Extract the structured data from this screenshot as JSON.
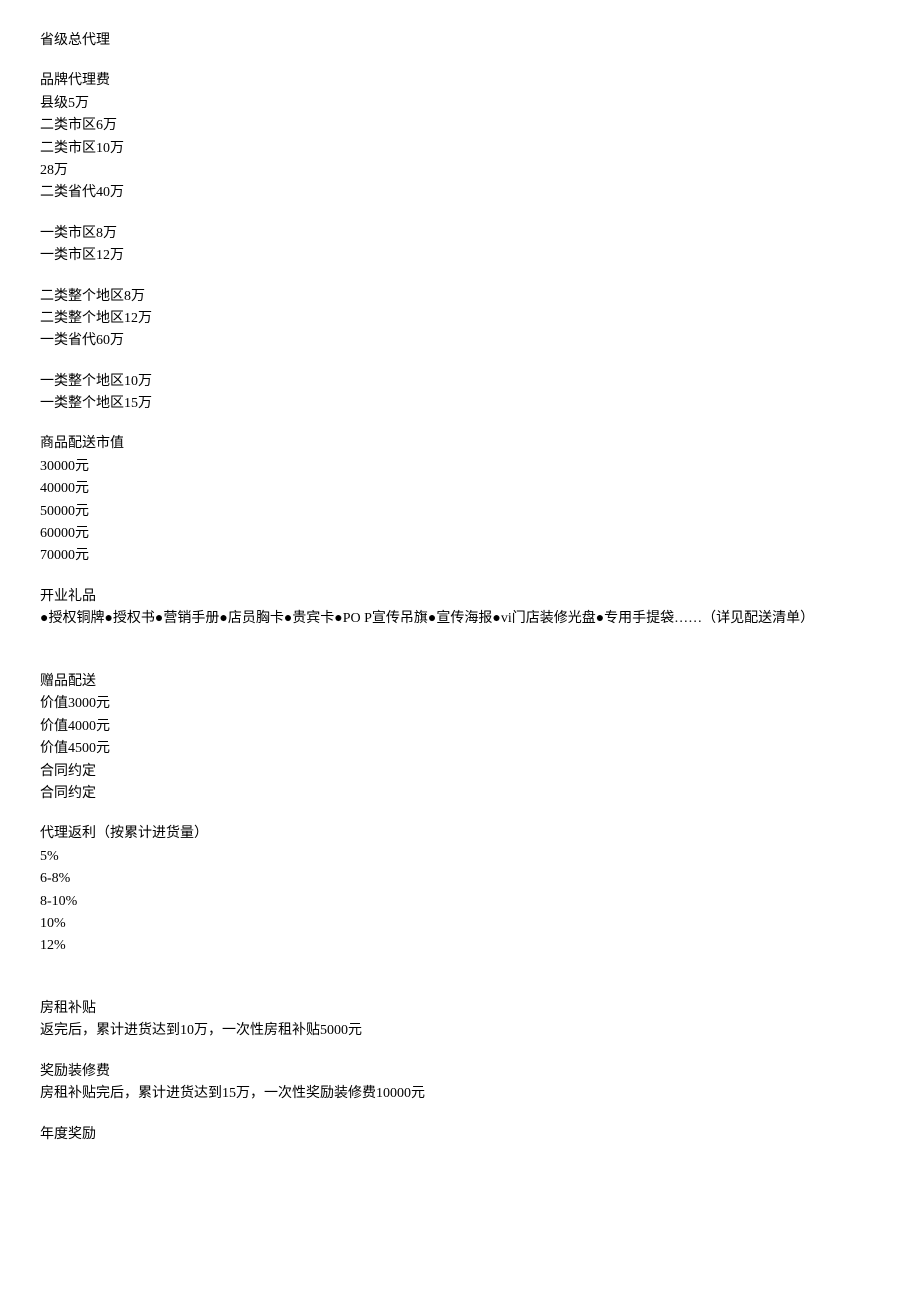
{
  "sections": [
    {
      "lines": [
        "省级总代理"
      ]
    },
    {
      "lines": [
        "品牌代理费",
        "县级5万",
        "二类市区6万",
        "二类市区10万",
        "28万",
        "二类省代40万"
      ]
    },
    {
      "lines": [
        "一类市区8万",
        "一类市区12万"
      ]
    },
    {
      "lines": [
        "二类整个地区8万",
        "二类整个地区12万",
        "一类省代60万"
      ]
    },
    {
      "lines": [
        "一类整个地区10万",
        "一类整个地区15万"
      ]
    },
    {
      "lines": [
        "商品配送市值",
        "30000元",
        "40000元",
        "50000元",
        "60000元",
        "70000元"
      ]
    },
    {
      "lines": [
        "开业礼品",
        "●授权铜牌●授权书●营销手册●店员胸卡●贵宾卡●PO P宣传吊旗●宣传海报●vi门店装修光盘●专用手提袋……（详见配送清单）"
      ]
    },
    {
      "lines": [
        "",
        "赠品配送",
        "价值3000元",
        "价值4000元",
        "价值4500元",
        "合同约定",
        "合同约定"
      ]
    },
    {
      "lines": [
        "代理返利（按累计进货量）",
        "5%",
        "6-8%",
        "8-10%",
        "10%",
        "12%"
      ]
    },
    {
      "lines": [
        "",
        "房租补贴",
        "返完后，累计进货达到10万，一次性房租补贴5000元"
      ]
    },
    {
      "lines": [
        "奖励装修费",
        "房租补贴完后，累计进货达到15万，一次性奖励装修费10000元"
      ]
    },
    {
      "lines": [
        "年度奖励"
      ]
    }
  ]
}
